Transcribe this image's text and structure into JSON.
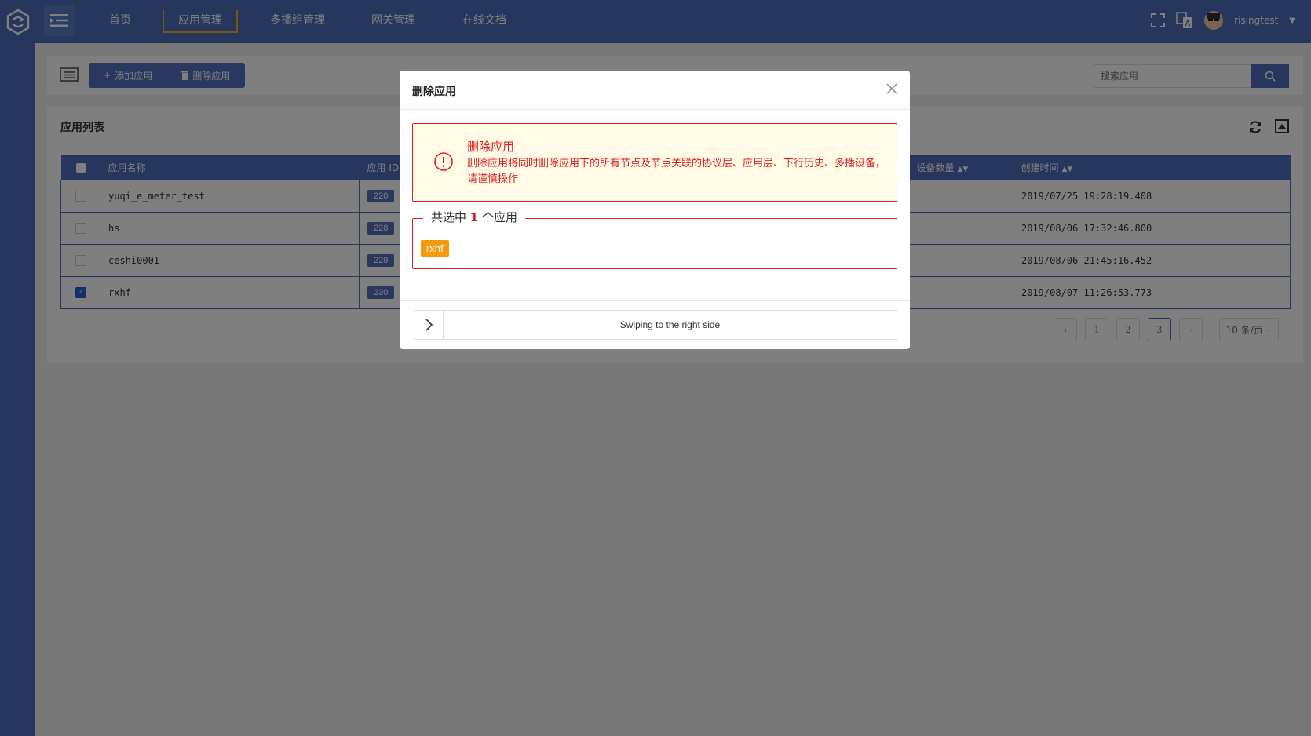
{
  "header": {
    "nav": [
      {
        "label": "首页"
      },
      {
        "label": "应用管理"
      },
      {
        "label": "多播组管理"
      },
      {
        "label": "网关管理"
      },
      {
        "label": "在线文档"
      }
    ],
    "active_nav": "应用管理",
    "username": "risingtest"
  },
  "toolbar": {
    "add_label": "添加应用",
    "delete_label": "删除应用",
    "search_placeholder": "搜索应用"
  },
  "list": {
    "title": "应用列表",
    "columns": [
      "应用名称",
      "应用 ID",
      "设备数量",
      "创建时间"
    ],
    "rows": [
      {
        "name": "yuqi_e_meter_test",
        "id": "220",
        "created": "2019/07/25 19:28:19.408",
        "checked": false
      },
      {
        "name": "hs",
        "id": "228",
        "created": "2019/08/06 17:32:46.800",
        "checked": false
      },
      {
        "name": "ceshi0001",
        "id": "229",
        "created": "2019/08/06 21:45:16.452",
        "checked": false
      },
      {
        "name": "rxhf",
        "id": "230",
        "created": "2019/08/07 11:26:53.773",
        "checked": true
      }
    ]
  },
  "pagination": {
    "pages": [
      "1",
      "2",
      "3"
    ],
    "current": "3",
    "page_size": "10 条/页"
  },
  "modal": {
    "title": "删除应用",
    "alert_title": "删除应用",
    "alert_desc": "删除应用将同时删除应用下的所有节点及节点关联的协议层、应用层、下行历史、多播设备，请谨慎操作",
    "selected_prefix": "共选中",
    "selected_count": "1",
    "selected_suffix": "个应用",
    "selected_tags": [
      "rxhf"
    ],
    "slider_text": "Swiping to the right side"
  },
  "colors": {
    "primary": "#4f6db8",
    "danger": "#e02020",
    "tag": "#f59a0b",
    "active_nav_border": "#f5a623"
  }
}
